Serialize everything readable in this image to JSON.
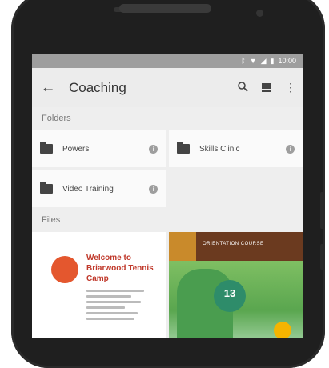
{
  "status": {
    "time": "10:00"
  },
  "appbar": {
    "title": "Coaching",
    "back_icon": "arrow-back-icon",
    "search_icon": "search-icon",
    "view_icon": "list-view-icon",
    "more_icon": "overflow-menu-icon"
  },
  "sections": {
    "folders": "Folders",
    "files": "Files"
  },
  "folders": [
    {
      "name": "Powers"
    },
    {
      "name": "Skills Clinic"
    },
    {
      "name": "Video Training"
    }
  ],
  "files": {
    "doc": {
      "title": "Welcome to Briarwood Tennis Camp"
    },
    "photo": {
      "banner": "ORIENTATION COURSE",
      "badge_number": "13"
    }
  },
  "colors": {
    "statusbar": "#9e9e9e",
    "background": "#eeeeee",
    "doc_title": "#c0392b",
    "photo_header": "#6b3a1f",
    "badge": "#2e8c6a",
    "fab": "#f5b400"
  }
}
